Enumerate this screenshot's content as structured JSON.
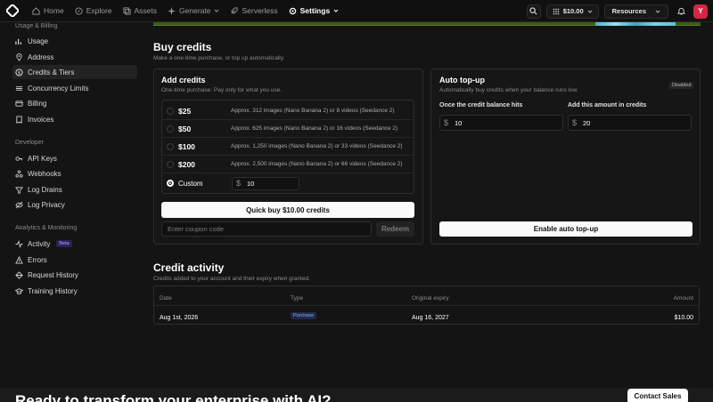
{
  "colors": {
    "accent_red": "#d62644",
    "beta_purple": "#b4a3ff",
    "badge_blue": "#8ea9ff"
  },
  "topnav": {
    "items": [
      {
        "label": "Home",
        "icon": "home-icon"
      },
      {
        "label": "Explore",
        "icon": "compass-icon"
      },
      {
        "label": "Assets",
        "icon": "assets-icon"
      },
      {
        "label": "Generate",
        "icon": "sparkle-icon",
        "dropdown": true
      },
      {
        "label": "Serverless",
        "icon": "rocket-icon"
      },
      {
        "label": "Settings",
        "icon": "gear-icon",
        "dropdown": true,
        "active": true
      }
    ],
    "balance": "$10.00",
    "resources": "Resources",
    "avatar_initial": "Y"
  },
  "sidebar": {
    "sections": [
      {
        "heading": "Usage & Billing",
        "items": [
          {
            "label": "Usage",
            "icon": "usage-icon"
          },
          {
            "label": "Address",
            "icon": "pin-icon"
          },
          {
            "label": "Credits & Tiers",
            "icon": "dollar-icon",
            "active": true
          },
          {
            "label": "Concurrency Limits",
            "icon": "concurrency-icon"
          },
          {
            "label": "Billing",
            "icon": "card-icon"
          },
          {
            "label": "Invoices",
            "icon": "invoice-icon"
          }
        ]
      },
      {
        "heading": "Developer",
        "items": [
          {
            "label": "API Keys",
            "icon": "key-icon"
          },
          {
            "label": "Webhooks",
            "icon": "webhook-icon"
          },
          {
            "label": "Log Drains",
            "icon": "drain-icon"
          },
          {
            "label": "Log Privacy",
            "icon": "privacy-icon"
          }
        ]
      },
      {
        "heading": "Analytics & Monitoring",
        "items": [
          {
            "label": "Activity",
            "icon": "activity-icon",
            "badge": "Beta"
          },
          {
            "label": "Errors",
            "icon": "error-icon"
          },
          {
            "label": "Request History",
            "icon": "history-icon"
          },
          {
            "label": "Training History",
            "icon": "training-icon"
          }
        ]
      }
    ]
  },
  "buy_credits": {
    "title": "Buy credits",
    "subtitle": "Make a one-time purchase, or top up automatically.",
    "add": {
      "title": "Add credits",
      "subtitle": "One-time purchase. Pay only for what you use.",
      "options": [
        {
          "price": "$25",
          "desc": "Approx. 312 images (Nano Banana 2) or 8 videos (Seedance 2)"
        },
        {
          "price": "$50",
          "desc": "Approx. 625 images (Nano Banana 2) or 16 videos (Seedance 2)"
        },
        {
          "price": "$100",
          "desc": "Approx. 1,250 images (Nano Banana 2) or 33 videos (Seedance 2)"
        },
        {
          "price": "$200",
          "desc": "Approx. 2,500 images (Nano Banana 2) or 66 videos (Seedance 2)"
        }
      ],
      "custom_label": "Custom",
      "custom_currency": "$",
      "custom_value": "10",
      "quick_buy": "Quick buy $10.00 credits",
      "coupon_placeholder": "Enter coupon code",
      "redeem": "Redeem"
    },
    "auto": {
      "title": "Auto top-up",
      "subtitle": "Automatically buy credits when your balance runs low.",
      "status": "Disabled",
      "threshold_label": "Once the credit balance hits",
      "threshold_currency": "$",
      "threshold_value": "10",
      "amount_label": "Add this amount in credits",
      "amount_currency": "$",
      "amount_value": "20",
      "enable": "Enable auto top-up"
    }
  },
  "activity": {
    "title": "Credit activity",
    "subtitle": "Credits added to your account and their expiry when granted.",
    "columns": [
      "Date",
      "Type",
      "Original expiry",
      "Amount"
    ],
    "rows": [
      {
        "date": "Aug 1st, 2026",
        "type": "Purchase",
        "expiry": "Aug 16, 2027",
        "amount": "$10.00"
      }
    ]
  },
  "footer": {
    "headline": "Ready to transform your enterprise with AI?",
    "cta": "Contact Sales"
  }
}
